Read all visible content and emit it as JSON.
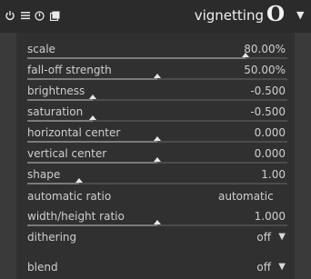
{
  "header": {
    "title": "vignetting",
    "icons": [
      "power-icon",
      "hamburger-menu-icon",
      "reset-icon",
      "duplicate-instance-icon",
      "preset-icon",
      "presets-menu-arrow-icon"
    ]
  },
  "params": {
    "scale": {
      "label": "scale",
      "value": "80.00%",
      "slider_fraction": 0.84
    },
    "falloff": {
      "label": "fall-off strength",
      "value": "50.00%",
      "slider_fraction": 0.5
    },
    "brightness": {
      "label": "brightness",
      "value": "-0.500",
      "slider_fraction": 0.25
    },
    "saturation": {
      "label": "saturation",
      "value": "-0.500",
      "slider_fraction": 0.25
    },
    "hcenter": {
      "label": "horizontal center",
      "value": "0.000",
      "slider_fraction": 0.5
    },
    "vcenter": {
      "label": "vertical center",
      "value": "0.000",
      "slider_fraction": 0.5
    },
    "shape": {
      "label": "shape",
      "value": "1.00",
      "slider_fraction": 0.2
    },
    "auto_ratio": {
      "label": "automatic ratio",
      "value": "automatic"
    },
    "whratio": {
      "label": "width/height ratio",
      "value": "1.000",
      "slider_fraction": 0.5
    },
    "dithering": {
      "label": "dithering",
      "value": "off"
    },
    "blend": {
      "label": "blend",
      "value": "off"
    }
  },
  "colors": {
    "background": "#3a3a3a",
    "header": "#2b2b2b",
    "panel": "#303030",
    "text": "#cfcfcf",
    "marker": "#e8e8e8"
  }
}
